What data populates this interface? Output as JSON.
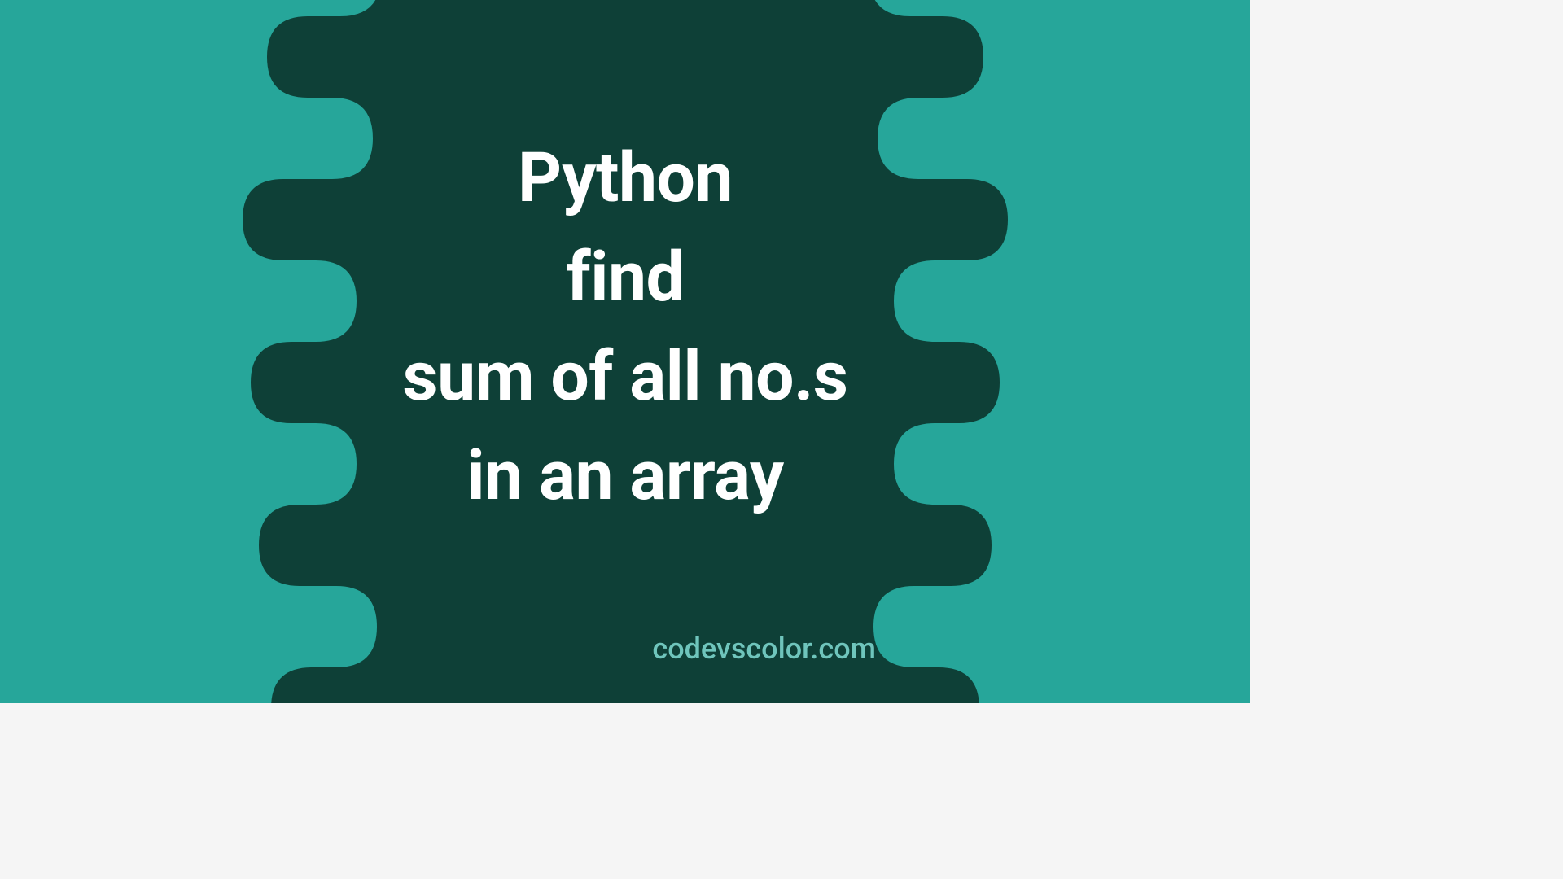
{
  "title": {
    "line1": "Python",
    "line2": "find",
    "line3": "sum of all no.s",
    "line4": "in an array"
  },
  "watermark": "codevscolor.com",
  "colors": {
    "background": "#26a69a",
    "blob": "#0e4037",
    "text": "#ffffff",
    "watermark": "#6fc5bc"
  }
}
